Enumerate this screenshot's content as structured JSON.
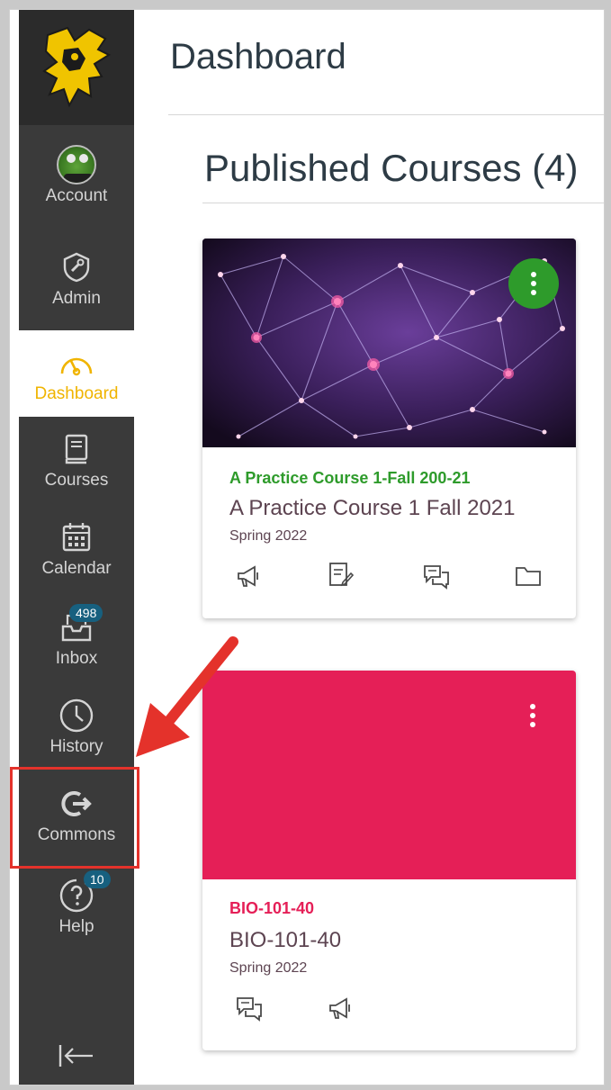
{
  "header": {
    "title": "Dashboard"
  },
  "section": {
    "title": "Published Courses (4)"
  },
  "nav": {
    "account": "Account",
    "admin": "Admin",
    "dashboard": "Dashboard",
    "courses": "Courses",
    "calendar": "Calendar",
    "inbox": "Inbox",
    "inbox_badge": "498",
    "history": "History",
    "commons": "Commons",
    "help": "Help",
    "help_badge": "10"
  },
  "courses": [
    {
      "code": "A Practice Course 1-Fall 200-21",
      "name": "A Practice Course 1 Fall 2021",
      "term": "Spring 2022",
      "color": "#2e9b2b",
      "hero": "network-image",
      "tools": [
        "announcements-icon",
        "assignments-icon",
        "discussions-icon",
        "files-icon"
      ]
    },
    {
      "code": "BIO-101-40",
      "name": "BIO-101-40",
      "term": "Spring 2022",
      "color": "#e51f57",
      "tools": [
        "discussions-icon",
        "announcements-icon"
      ]
    }
  ],
  "colors": {
    "nav_bg": "#3a3a3a",
    "nav_active": "#f0b400",
    "highlight": "#e4322b"
  }
}
